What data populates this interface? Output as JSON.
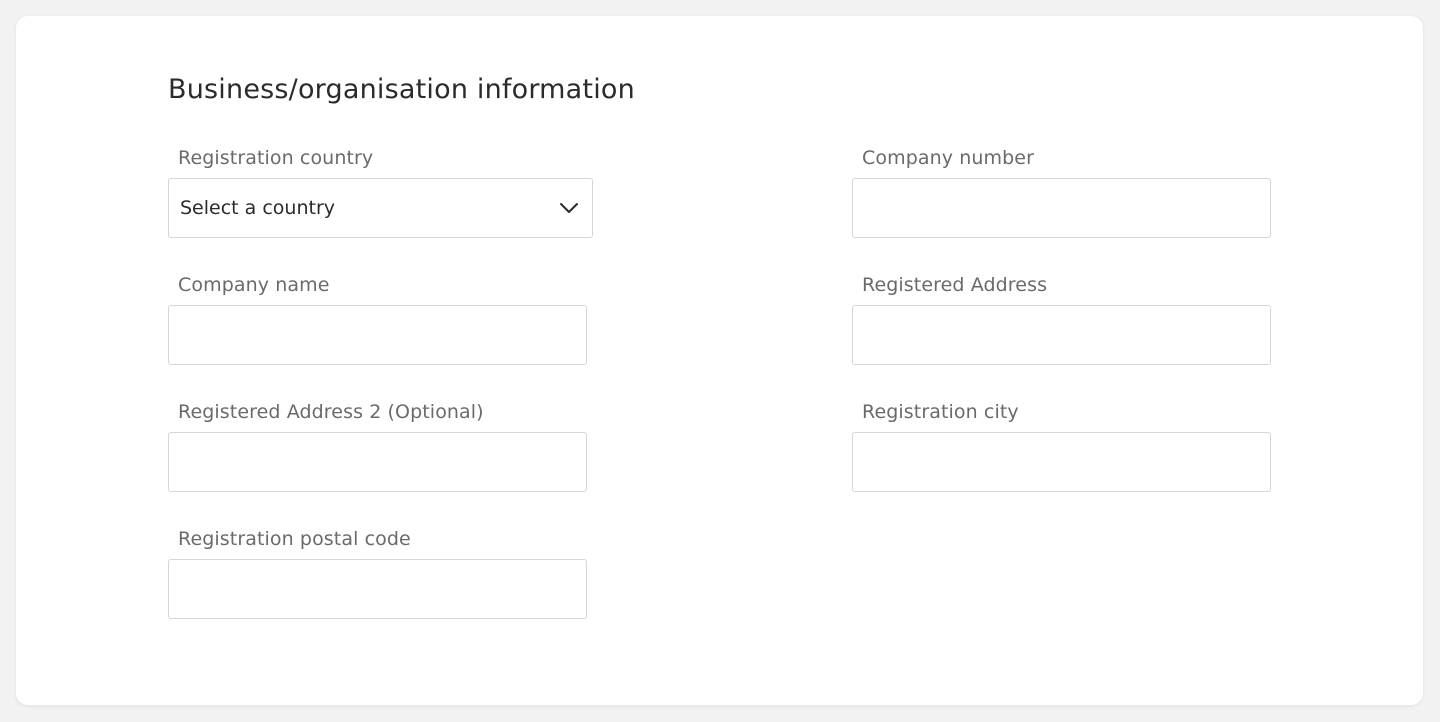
{
  "form": {
    "title": "Business/organisation information",
    "registration_country": {
      "label": "Registration country",
      "selected_value": "Select a country",
      "icon": "chevron-down-icon"
    },
    "company_number": {
      "label": "Company number",
      "value": ""
    },
    "company_name": {
      "label": "Company name",
      "value": ""
    },
    "registered_address": {
      "label": "Registered Address",
      "value": ""
    },
    "registered_address_2": {
      "label": "Registered Address 2 (Optional)",
      "value": ""
    },
    "registration_city": {
      "label": "Registration city",
      "value": ""
    },
    "registration_postal_code": {
      "label": "Registration postal code",
      "value": ""
    }
  },
  "colors": {
    "background": "#f2f2f2",
    "card": "#ffffff",
    "label_text": "#6a6a6a",
    "title_text": "#2b2b2b",
    "input_border": "#d6d6d6"
  }
}
